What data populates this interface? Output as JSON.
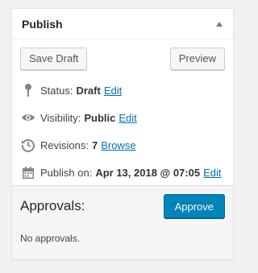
{
  "box": {
    "title": "Publish"
  },
  "actions": {
    "save_draft_label": "Save Draft",
    "preview_label": "Preview"
  },
  "status": {
    "label": "Status:",
    "value": "Draft",
    "edit": "Edit",
    "icon": "pin-icon"
  },
  "visibility": {
    "label": "Visibility:",
    "value": "Public",
    "edit": "Edit",
    "icon": "eye-icon"
  },
  "revisions": {
    "label": "Revisions:",
    "value": "7",
    "browse": "Browse",
    "icon": "history-icon"
  },
  "publish_on": {
    "label": "Publish on:",
    "value": "Apr 13, 2018 @ 07:05",
    "edit": "Edit",
    "icon": "calendar-icon"
  },
  "approvals": {
    "title": "Approvals:",
    "approve_label": "Approve",
    "empty_text": "No approvals."
  },
  "colors": {
    "link": "#0073aa",
    "primary": "#0085ba",
    "panel_bg": "#f5f5f5"
  }
}
